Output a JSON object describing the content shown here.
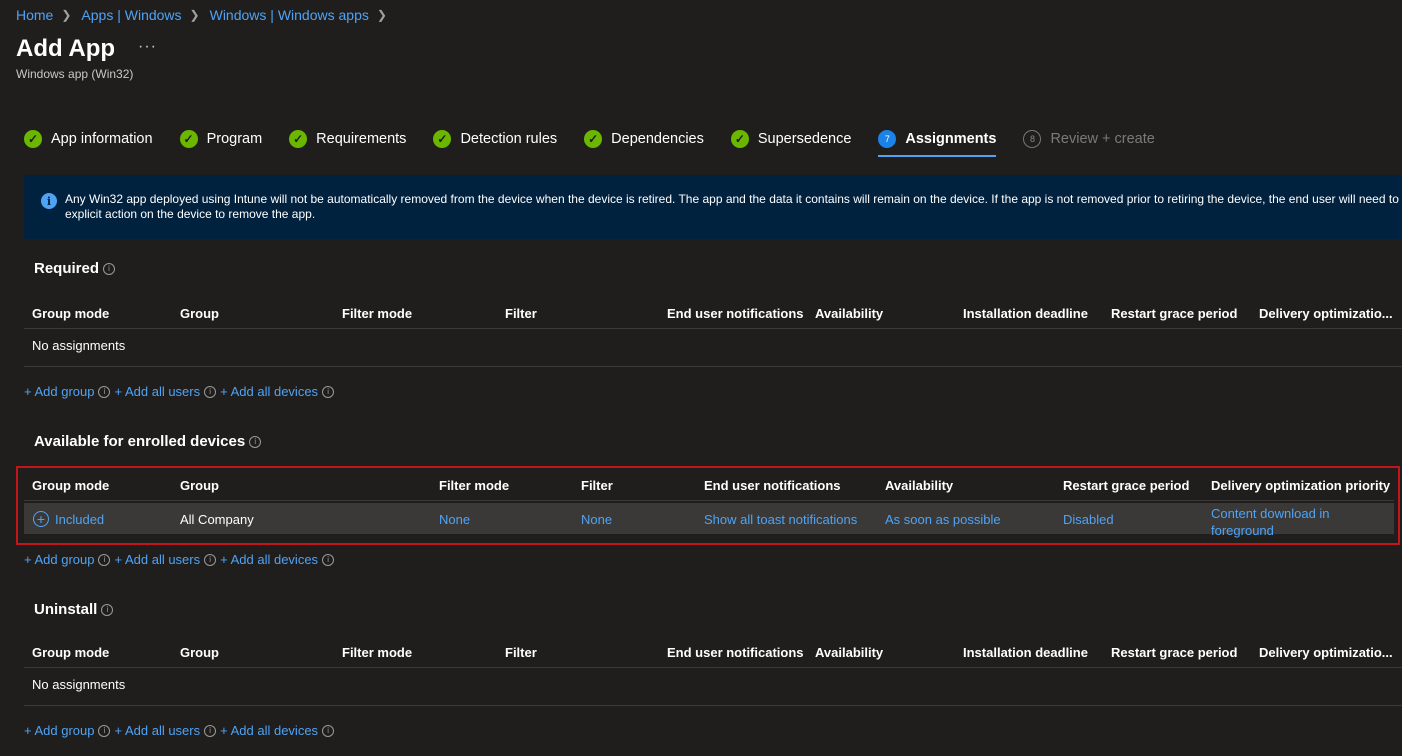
{
  "breadcrumb": [
    "Home",
    "Apps | Windows",
    "Windows | Windows apps"
  ],
  "page": {
    "title": "Add App",
    "more": "···",
    "subtitle": "Windows app (Win32)"
  },
  "wizard": {
    "steps": [
      {
        "label": "App information",
        "state": "complete"
      },
      {
        "label": "Program",
        "state": "complete"
      },
      {
        "label": "Requirements",
        "state": "complete"
      },
      {
        "label": "Detection rules",
        "state": "complete"
      },
      {
        "label": "Dependencies",
        "state": "complete"
      },
      {
        "label": "Supersedence",
        "state": "complete"
      },
      {
        "label": "Assignments",
        "state": "active",
        "number": "7"
      },
      {
        "label": "Review + create",
        "state": "pending",
        "number": "8"
      }
    ]
  },
  "banner": {
    "text": "Any Win32 app deployed using Intune will not be automatically removed from the device when the device is retired. The app and the data it contains will remain on the device. If the app is not removed prior to retiring the device, the end user will need to take explicit action on the device to remove the app."
  },
  "add_links": {
    "add_group": "+ Add group",
    "add_all_users": "+ Add all users",
    "add_all_devices": "+ Add all devices"
  },
  "required": {
    "title": "Required",
    "columns": [
      "Group mode",
      "Group",
      "Filter mode",
      "Filter",
      "End user notifications",
      "Availability",
      "Installation deadline",
      "Restart grace period",
      "Delivery optimizatio..."
    ],
    "empty": "No assignments"
  },
  "available": {
    "title": "Available for enrolled devices",
    "columns": [
      "Group mode",
      "Group",
      "Filter mode",
      "Filter",
      "End user notifications",
      "Availability",
      "Restart grace period",
      "Delivery optimization priority"
    ],
    "row": {
      "group_mode": "Included",
      "group": "All Company",
      "filter_mode": "None",
      "filter": "None",
      "notifications": "Show all toast notifications",
      "availability": "As soon as possible",
      "restart_grace": "Disabled",
      "delivery_priority": "Content download in foreground"
    }
  },
  "uninstall": {
    "title": "Uninstall",
    "columns": [
      "Group mode",
      "Group",
      "Filter mode",
      "Filter",
      "End user notifications",
      "Availability",
      "Installation deadline",
      "Restart grace period",
      "Delivery optimizatio..."
    ],
    "empty": "No assignments"
  },
  "colors": {
    "accent": "#4fa3f5",
    "success": "#6bb700",
    "highlight": "#c3151c",
    "banner": "#01223f",
    "background": "#1f1e1d"
  }
}
